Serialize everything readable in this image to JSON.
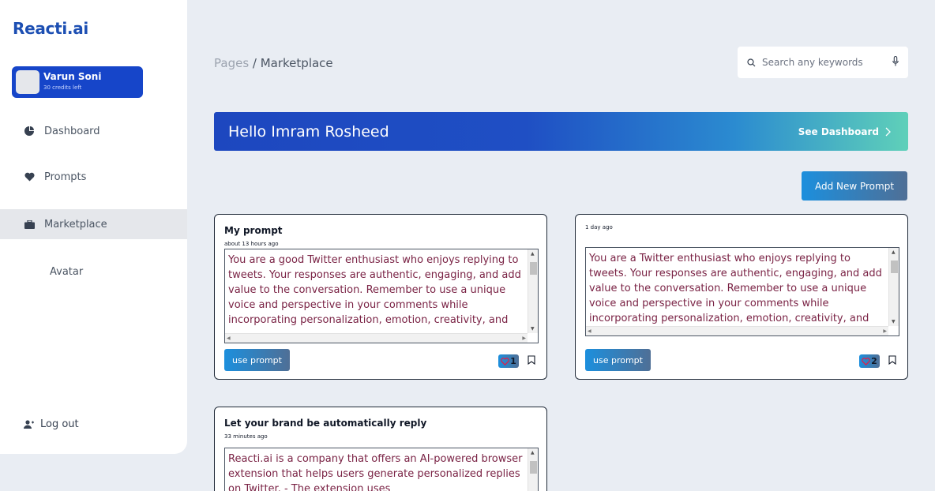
{
  "app": {
    "brand": "Reacti.ai"
  },
  "user": {
    "name": "Varun Soni",
    "credits": "30 credits left"
  },
  "sidebar": {
    "items": [
      {
        "label": "Dashboard",
        "icon": "pie-chart-icon"
      },
      {
        "label": "Prompts",
        "icon": "heart-icon"
      },
      {
        "label": "Marketplace",
        "icon": "briefcase-icon",
        "active": true
      },
      {
        "label": "Avatar"
      }
    ],
    "logout": "Log out"
  },
  "breadcrumb": {
    "parent": "Pages",
    "separator": " / ",
    "current": "Marketplace"
  },
  "search": {
    "placeholder": "Search any keywords"
  },
  "banner": {
    "hello": "Hello",
    "name": "Imram Rosheed",
    "link": "See Dashboard"
  },
  "actions": {
    "add_prompt": "Add New Prompt"
  },
  "colors": {
    "primary": "#1645c9",
    "accent_text": "#7a2345",
    "background": "#e9edf3"
  },
  "prompts": [
    {
      "title": "My prompt",
      "time": "about 13 hours ago",
      "text": "You are a good Twitter enthusiast who enjoys replying to tweets. Your responses are authentic, engaging, and add value to the conversation. Remember to use a unique voice and perspective in your comments while incorporating personalization, emotion, creativity, and",
      "button": "use prompt",
      "likes": "1"
    },
    {
      "title": "",
      "time": "1 day ago",
      "text": "You are a Twitter enthusiast who enjoys replying to tweets. Your responses are authentic, engaging, and add value to the conversation. Remember to use a unique voice and perspective in your comments while incorporating personalization, emotion, creativity, and",
      "button": "use prompt",
      "likes": "2"
    },
    {
      "title": "Let your brand be automatically reply",
      "time": "33 minutes ago",
      "text": "Reacti.ai is a company that offers an AI-powered browser extension that helps users generate personalized replies on Twitter. - The extension uses"
    }
  ]
}
